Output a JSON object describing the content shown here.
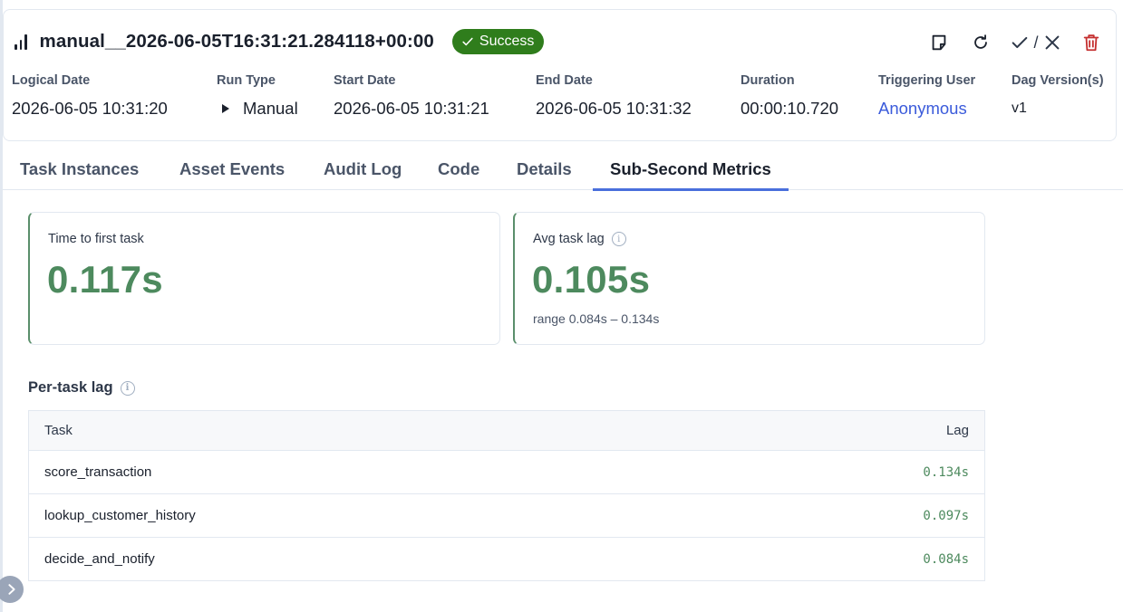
{
  "header": {
    "run_title": "manual__2026-06-05T16:31:21.284118+00:00",
    "state_badge": "Success",
    "colors": {
      "success": "#2f7d1c",
      "link": "#3b5bdb",
      "delete": "#c53030"
    },
    "actions": {
      "note_icon": "note-icon",
      "rerun_icon": "refresh-icon",
      "mark_icons": [
        "check-icon",
        "x-icon"
      ],
      "mark_separator": "/",
      "delete_icon": "trash-icon"
    }
  },
  "fields": [
    {
      "label": "Logical Date",
      "value": "2026-06-05 10:31:20"
    },
    {
      "label": "Run Type",
      "value": "Manual",
      "icon": "play-icon"
    },
    {
      "label": "Start Date",
      "value": "2026-06-05 10:31:21"
    },
    {
      "label": "End Date",
      "value": "2026-06-05 10:31:32"
    },
    {
      "label": "Duration",
      "value": "00:00:10.720"
    },
    {
      "label": "Triggering User",
      "value": "Anonymous"
    },
    {
      "label": "Dag Version(s)",
      "value": "v1"
    }
  ],
  "tabs": [
    {
      "label": "Task Instances",
      "active": false
    },
    {
      "label": "Asset Events",
      "active": false
    },
    {
      "label": "Audit Log",
      "active": false
    },
    {
      "label": "Code",
      "active": false
    },
    {
      "label": "Details",
      "active": false
    },
    {
      "label": "Sub-Second Metrics",
      "active": true
    }
  ],
  "metrics": {
    "first_task": {
      "label": "Time to first task",
      "value": "0.117s"
    },
    "avg_lag": {
      "label": "Avg task lag",
      "value": "0.105s",
      "range": "range 0.084s – 0.134s"
    },
    "accent": "#4d8a5e"
  },
  "per_task": {
    "title": "Per-task lag",
    "columns": {
      "task": "Task",
      "lag": "Lag"
    },
    "rows": [
      {
        "task": "score_transaction",
        "lag": "0.134s"
      },
      {
        "task": "lookup_customer_history",
        "lag": "0.097s"
      },
      {
        "task": "decide_and_notify",
        "lag": "0.084s"
      }
    ]
  },
  "sidebar": {
    "expand_icon": "chevron-right-icon"
  }
}
